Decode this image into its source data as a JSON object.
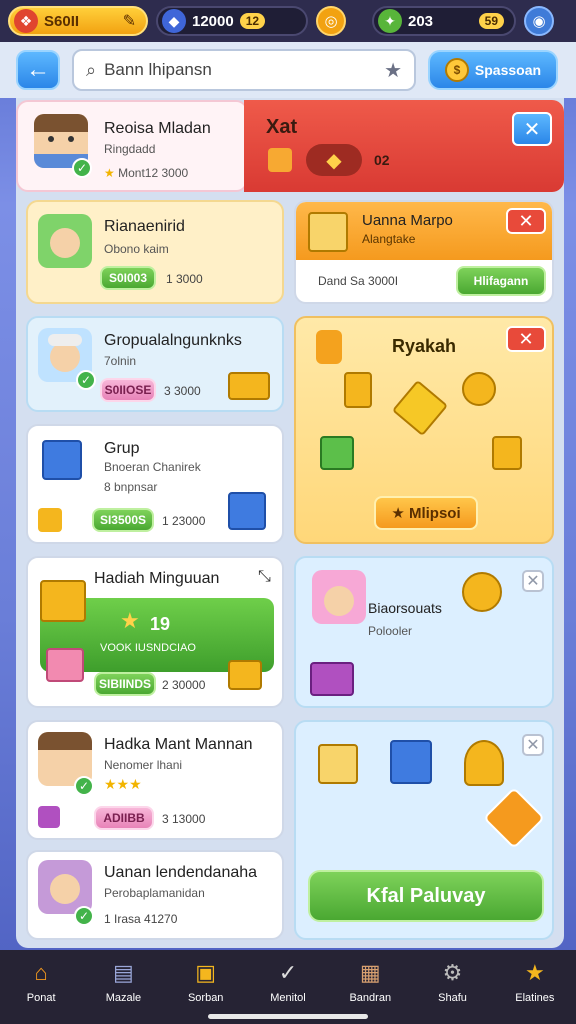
{
  "topbar": {
    "coins_value": "S60II",
    "gems_value": "12000",
    "gems_badge": "12",
    "energy_value": "203",
    "energy_badge": "59"
  },
  "search": {
    "query": "Bann lhipansn",
    "scan_label": "Spassoan"
  },
  "profile": {
    "name": "Reoisa Mladan",
    "subtitle": "Ringdadd",
    "stat": "Mont12 3000",
    "banner_title": "Xat",
    "banner_value": "02"
  },
  "cards_left": [
    {
      "title": "Rianaenirid",
      "subtitle": "Obono kaim",
      "chip": "S0I003",
      "value": "1 3000"
    },
    {
      "title": "Gropualalngunknks",
      "subtitle": "7olnin",
      "chip": "S0IIOSE",
      "value": "3 3000"
    },
    {
      "title": "Grup",
      "subtitle": "Bnoeran Chanirek",
      "subtitle2": "8 bnpnsar",
      "chip": "SI3500S",
      "value": "1 23000"
    },
    {
      "title": "Hadiah Minguuan",
      "reward_value": "19",
      "reward_label": "VOOK IUSNDCIAO",
      "chip": "SIBIINDS",
      "value": "2 30000"
    },
    {
      "title": "Hadka Mant Mannan",
      "subtitle": "Nenomer lhani",
      "chip": "ADIIBB",
      "value": "3 13000"
    },
    {
      "title": "Uanan lendendanaha",
      "subtitle": "Perobaplamanidan",
      "value": "1 Irasa 41270"
    }
  ],
  "cards_right": [
    {
      "title": "Uanna Marpo",
      "subtitle": "Alangtake",
      "value": "Dand Sa 3000I",
      "button": "Hlifagann"
    },
    {
      "title": "Ryakah",
      "button": "Mlipsoi"
    },
    {
      "title": "Biaorsouats",
      "subtitle": "Polooler"
    }
  ],
  "cta": {
    "label": "Kfal Paluvay"
  },
  "nav": [
    {
      "label": "Ponat",
      "icon": "home-icon"
    },
    {
      "label": "Mazale",
      "icon": "cards-icon"
    },
    {
      "label": "Sorban",
      "icon": "chest-icon"
    },
    {
      "label": "Menitol",
      "icon": "check-icon"
    },
    {
      "label": "Bandran",
      "icon": "box-icon"
    },
    {
      "label": "Shafu",
      "icon": "gear-icon"
    },
    {
      "label": "Elatines",
      "icon": "star-icon"
    }
  ],
  "colors": {
    "accent_blue": "#2b86e8",
    "accent_green": "#4aa832",
    "accent_red": "#d93a33",
    "accent_gold": "#f2a211"
  }
}
